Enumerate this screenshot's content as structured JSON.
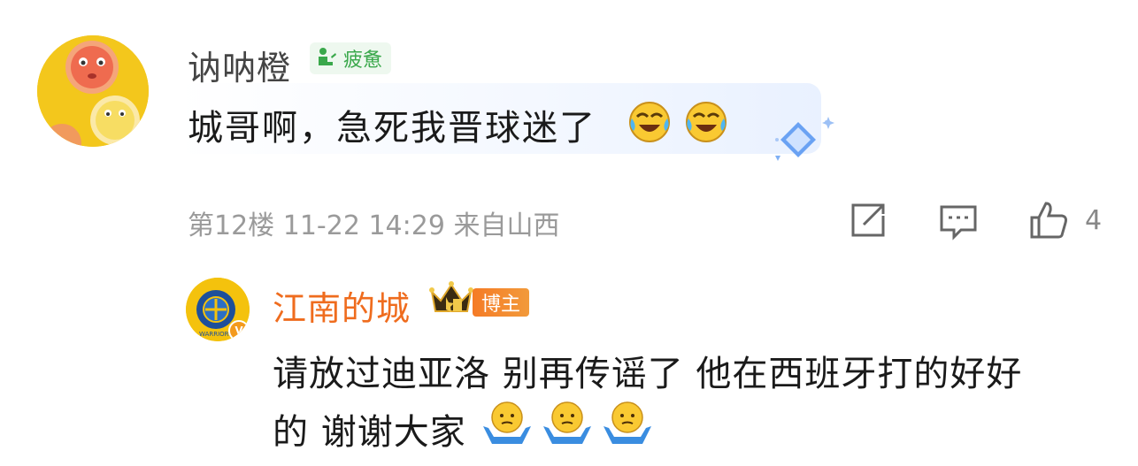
{
  "comment": {
    "username": "讷呐橙",
    "mood_label": "疲惫",
    "text": "城哥啊，急死我晋球迷了",
    "floor": "第12楼",
    "date": "11-22",
    "time": "14:29",
    "location": "来自山西",
    "like_count": "4",
    "emoji_after_text": [
      "laughing-crying",
      "laughing-crying"
    ]
  },
  "reply": {
    "username": "江南的城",
    "badge_label": "博主",
    "avatar_text": "WARRIORS",
    "verified_mark": "V",
    "line1": "请放过迪亚洛 别再传谣了 他在西班牙打的好好",
    "line2": "的 谢谢大家",
    "emoji_after_text": [
      "shrug",
      "shrug",
      "shrug"
    ]
  },
  "colors": {
    "reply_username": "#ef6c1e",
    "mood_green": "#3aa84b",
    "meta_grey": "#9a9a9a"
  }
}
